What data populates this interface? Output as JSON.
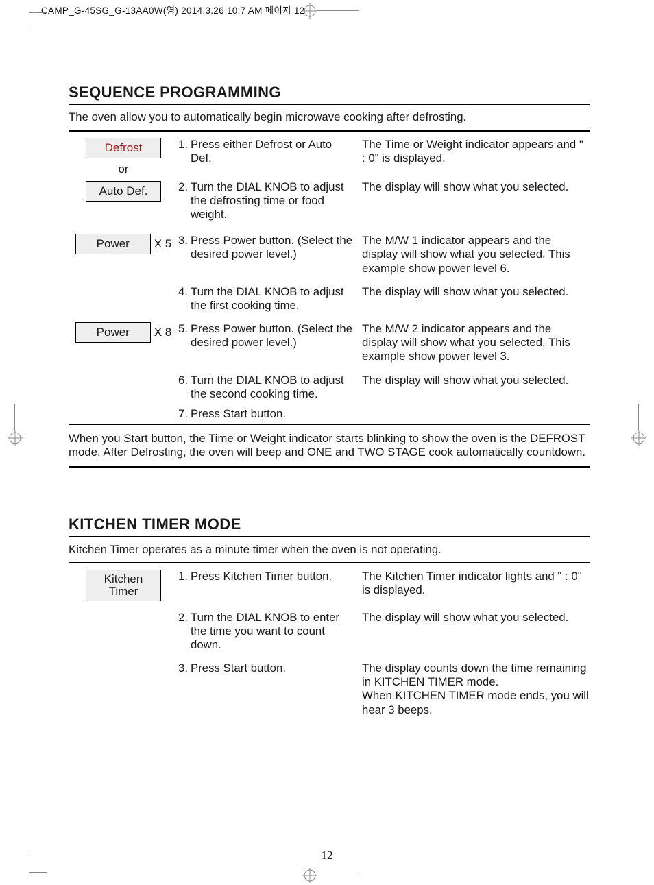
{
  "header_strip": "CAMP_G-45SG_G-13AA0W(영)  2014.3.26 10:7 AM  페이지 12",
  "page_number": "12",
  "sequence": {
    "title": "SEQUENCE PROGRAMMING",
    "intro": "The oven allow you to automatically begin microwave cooking after defrosting.",
    "post_note": "When you Start button, the Time or Weight indicator starts blinking to show the oven is the DEFROST mode. After Defrosting, the oven will beep and ONE and TWO STAGE cook automatically countdown.",
    "buttons": {
      "defrost": "Defrost",
      "or": "or",
      "auto_def": "Auto Def.",
      "power": "Power"
    },
    "x_counts": {
      "step3": "X 5",
      "step5": "X 8"
    },
    "steps": [
      {
        "num": "1.",
        "instr": "Press either Defrost  or Auto Def.",
        "disp": "The Time or Weight indicator appears and \" : 0\" is displayed."
      },
      {
        "num": "2.",
        "instr": "Turn the DIAL KNOB to adjust the defrosting time or food weight.",
        "disp": "The display will show what you selected."
      },
      {
        "num": "3.",
        "instr": "Press Power button. (Select the desired power level.)",
        "disp": "The M/W 1 indicator appears and the display will show what you selected. This example show power level 6."
      },
      {
        "num": "4.",
        "instr": "Turn the DIAL KNOB to adjust the first cooking time.",
        "disp": "The display will show what you selected."
      },
      {
        "num": "5.",
        "instr": "Press Power button. (Select the desired power level.)",
        "disp": "The M/W 2 indicator appears and the display will show what you selected. This example show power level 3."
      },
      {
        "num": "6.",
        "instr": "Turn the DIAL KNOB to adjust the second cooking time.",
        "disp": "The display will show what you selected."
      },
      {
        "num": "7.",
        "instr": "Press Start button.",
        "disp": ""
      }
    ]
  },
  "timer": {
    "title": "KITCHEN TIMER MODE",
    "intro": "Kitchen Timer operates as a minute timer when the oven is not operating.",
    "buttons": {
      "kitchen_timer": "Kitchen Timer"
    },
    "steps": [
      {
        "num": "1.",
        "instr": "Press Kitchen Timer button.",
        "disp": "The Kitchen Timer indicator lights and \" : 0\" is displayed."
      },
      {
        "num": "2.",
        "instr": "Turn the DIAL KNOB to enter the time you want to count down.",
        "disp": "The display will show what you selected."
      },
      {
        "num": "3.",
        "instr": "Press Start button.",
        "disp": "The display counts down the time remaining in KITCHEN TIMER mode.\nWhen KITCHEN TIMER mode ends, you will hear 3 beeps."
      }
    ]
  }
}
